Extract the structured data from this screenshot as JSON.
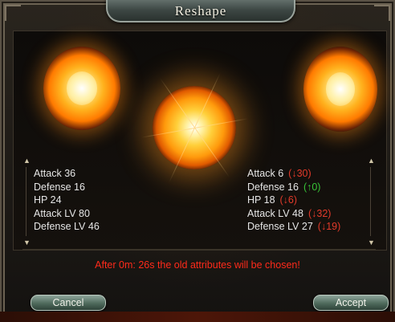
{
  "window": {
    "title": "Reshape"
  },
  "old_attributes": [
    {
      "label": "Attack 36"
    },
    {
      "label": "Defense 16"
    },
    {
      "label": "HP 24"
    },
    {
      "label": "Attack LV 80"
    },
    {
      "label": "Defense LV 46"
    }
  ],
  "new_attributes": [
    {
      "label": "Attack 6",
      "delta": "(↓30)",
      "direction": "down"
    },
    {
      "label": "Defense 16",
      "delta": "(↑0)",
      "direction": "up"
    },
    {
      "label": "HP 18",
      "delta": "(↓6)",
      "direction": "down"
    },
    {
      "label": "Attack LV 48",
      "delta": "(↓32)",
      "direction": "down"
    },
    {
      "label": "Defense LV 27",
      "delta": "(↓19)",
      "direction": "down"
    }
  ],
  "timer_message": "After 0m: 26s the old attributes will be chosen!",
  "buttons": {
    "cancel": "Cancel",
    "accept": "Accept"
  },
  "colors": {
    "down": "#e23a2a",
    "up": "#37c437",
    "timer": "#ff2a1a"
  },
  "icons": {
    "scroll_up": "chevron-up-icon",
    "scroll_down": "chevron-down-icon"
  }
}
